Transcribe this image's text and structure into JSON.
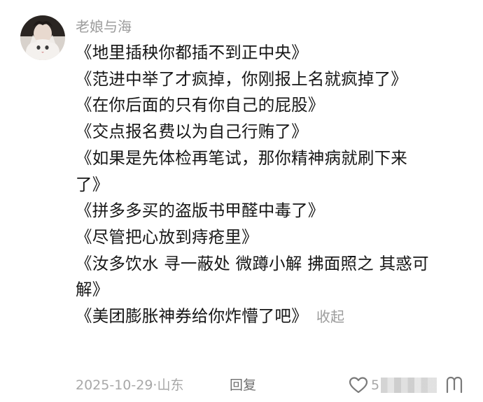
{
  "comment": {
    "username": "老娘与海",
    "lines": [
      "《地里插秧你都插不到正中央》",
      "《范进中举了才疯掉，你刚报上名就疯掉了》",
      "《在你后面的只有你自己的屁股》",
      "《交点报名费以为自己行贿了》",
      "《如果是先体检再笔试，那你精神病就刷下来",
      "了》",
      "《拼多多买的盗版书甲醛中毒了》",
      "《尽管把心放到痔疮里》",
      "《汝多饮水 寻一蔽处 微蹲小解 拂面照之 其惑可",
      "解》",
      "《美团膨胀神券给你炸懵了吧》"
    ],
    "collapse_label": "收起",
    "date": "2025-10-29",
    "separator": "·",
    "location": "山东",
    "reply_label": "回复",
    "like_count": "5"
  },
  "icons": {
    "avatar": "avatar-cat-image",
    "like": "heart-outline-icon",
    "dislike": "dislike-icon"
  },
  "colors": {
    "text": "#161616",
    "muted": "#9c9c9c",
    "reply": "#6f6f6f",
    "background": "#ffffff"
  }
}
